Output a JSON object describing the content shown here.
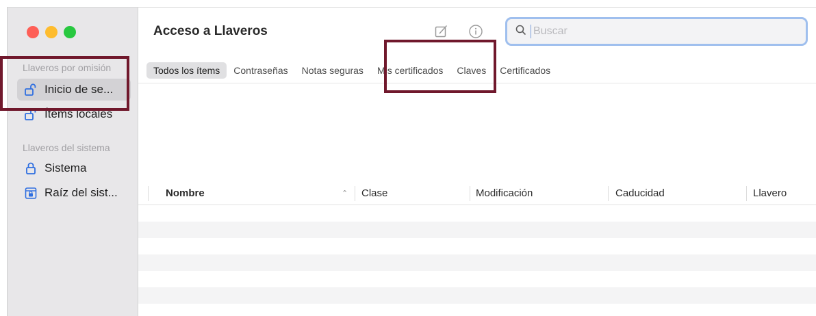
{
  "window": {
    "traffic_lights": {
      "red": "#fe5f57",
      "yellow": "#febc2e",
      "green": "#28c840"
    }
  },
  "sidebar": {
    "section_default": "Llaveros por omisión",
    "section_system": "Llaveros del sistema",
    "items": [
      {
        "label": "Inicio de se...",
        "icon": "lock-open-icon",
        "selected": true
      },
      {
        "label": "Ítems locales",
        "icon": "lock-open-icon",
        "selected": false
      },
      {
        "label": "Sistema",
        "icon": "lock-icon",
        "selected": false
      },
      {
        "label": "Raíz del sist...",
        "icon": "lock-cabinet-icon",
        "selected": false
      }
    ]
  },
  "header": {
    "title": "Acceso a Llaveros",
    "compose_icon": "compose-icon",
    "info_icon": "info-icon"
  },
  "search": {
    "placeholder": "Buscar",
    "value": "",
    "accent": "#9fbfee"
  },
  "tabs": [
    {
      "label": "Todos los ítems",
      "active": true
    },
    {
      "label": "Contraseñas",
      "active": false
    },
    {
      "label": "Notas seguras",
      "active": false
    },
    {
      "label": "Mis certificados",
      "active": false
    },
    {
      "label": "Claves",
      "active": false
    },
    {
      "label": "Certificados",
      "active": false
    }
  ],
  "table": {
    "columns": [
      "Nombre",
      "Clase",
      "Modificación",
      "Caducidad",
      "Llavero"
    ],
    "sort_indicator": "chevron-up-icon",
    "rows": []
  },
  "annotations": {
    "highlight_color": "#70182c"
  }
}
